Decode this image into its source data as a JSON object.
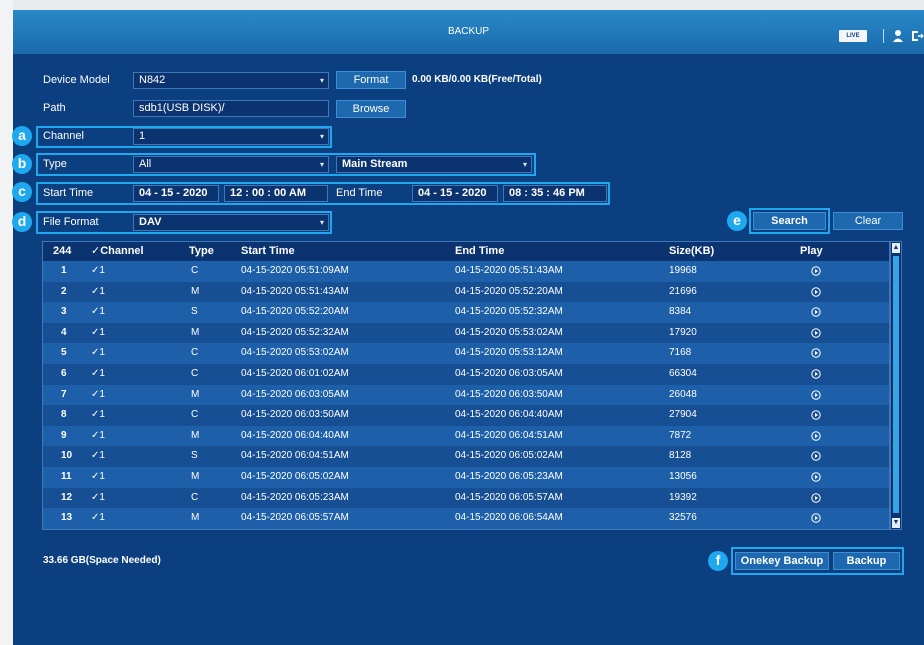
{
  "window": {
    "title": "BACKUP",
    "live_badge": "LIVE"
  },
  "form": {
    "device_model_label": "Device Model",
    "device_model_value": "N842",
    "format_button": "Format",
    "storage_info": "0.00 KB/0.00 KB(Free/Total)",
    "path_label": "Path",
    "path_value": "sdb1(USB DISK)/",
    "browse_button": "Browse",
    "channel_label": "Channel",
    "channel_value": "1",
    "type_label": "Type",
    "type_value": "All",
    "stream_value": "Main Stream",
    "start_time_label": "Start Time",
    "start_date": "04 - 15 - 2020",
    "start_time": "12 : 00 : 00 AM",
    "end_time_label": "End Time",
    "end_date": "04 - 15 - 2020",
    "end_time": "08 : 35 : 46 PM",
    "file_format_label": "File Format",
    "file_format_value": "DAV",
    "search_button": "Search",
    "clear_button": "Clear"
  },
  "callouts": {
    "a": "a",
    "b": "b",
    "c": "c",
    "d": "d",
    "e": "e",
    "f": "f"
  },
  "table": {
    "headers": {
      "count": "244",
      "channel": "✓Channel",
      "type": "Type",
      "start": "Start Time",
      "end": "End Time",
      "size": "Size(KB)",
      "play": "Play"
    },
    "rows": [
      {
        "num": "1",
        "ch": "✓1",
        "type": "C",
        "start": "04-15-2020 05:51:09AM",
        "end": "04-15-2020 05:51:43AM",
        "size": "19968"
      },
      {
        "num": "2",
        "ch": "✓1",
        "type": "M",
        "start": "04-15-2020 05:51:43AM",
        "end": "04-15-2020 05:52:20AM",
        "size": "21696"
      },
      {
        "num": "3",
        "ch": "✓1",
        "type": "S",
        "start": "04-15-2020 05:52:20AM",
        "end": "04-15-2020 05:52:32AM",
        "size": "8384"
      },
      {
        "num": "4",
        "ch": "✓1",
        "type": "M",
        "start": "04-15-2020 05:52:32AM",
        "end": "04-15-2020 05:53:02AM",
        "size": "17920"
      },
      {
        "num": "5",
        "ch": "✓1",
        "type": "C",
        "start": "04-15-2020 05:53:02AM",
        "end": "04-15-2020 05:53:12AM",
        "size": "7168"
      },
      {
        "num": "6",
        "ch": "✓1",
        "type": "C",
        "start": "04-15-2020 06:01:02AM",
        "end": "04-15-2020 06:03:05AM",
        "size": "66304"
      },
      {
        "num": "7",
        "ch": "✓1",
        "type": "M",
        "start": "04-15-2020 06:03:05AM",
        "end": "04-15-2020 06:03:50AM",
        "size": "26048"
      },
      {
        "num": "8",
        "ch": "✓1",
        "type": "C",
        "start": "04-15-2020 06:03:50AM",
        "end": "04-15-2020 06:04:40AM",
        "size": "27904"
      },
      {
        "num": "9",
        "ch": "✓1",
        "type": "M",
        "start": "04-15-2020 06:04:40AM",
        "end": "04-15-2020 06:04:51AM",
        "size": "7872"
      },
      {
        "num": "10",
        "ch": "✓1",
        "type": "S",
        "start": "04-15-2020 06:04:51AM",
        "end": "04-15-2020 06:05:02AM",
        "size": "8128"
      },
      {
        "num": "11",
        "ch": "✓1",
        "type": "M",
        "start": "04-15-2020 06:05:02AM",
        "end": "04-15-2020 06:05:23AM",
        "size": "13056"
      },
      {
        "num": "12",
        "ch": "✓1",
        "type": "C",
        "start": "04-15-2020 06:05:23AM",
        "end": "04-15-2020 06:05:57AM",
        "size": "19392"
      },
      {
        "num": "13",
        "ch": "✓1",
        "type": "M",
        "start": "04-15-2020 06:05:57AM",
        "end": "04-15-2020 06:06:54AM",
        "size": "32576"
      }
    ]
  },
  "footer": {
    "space_needed": "33.66 GB(Space Needed)",
    "onekey_backup_button": "Onekey Backup",
    "backup_button": "Backup"
  },
  "icons": {
    "user": "user-icon",
    "logout": "logout-icon",
    "play": "play-circle-icon"
  },
  "colors": {
    "background": "#0c3f7f",
    "titlebar": "#1a6aab",
    "highlight": "#1ea8f0"
  }
}
